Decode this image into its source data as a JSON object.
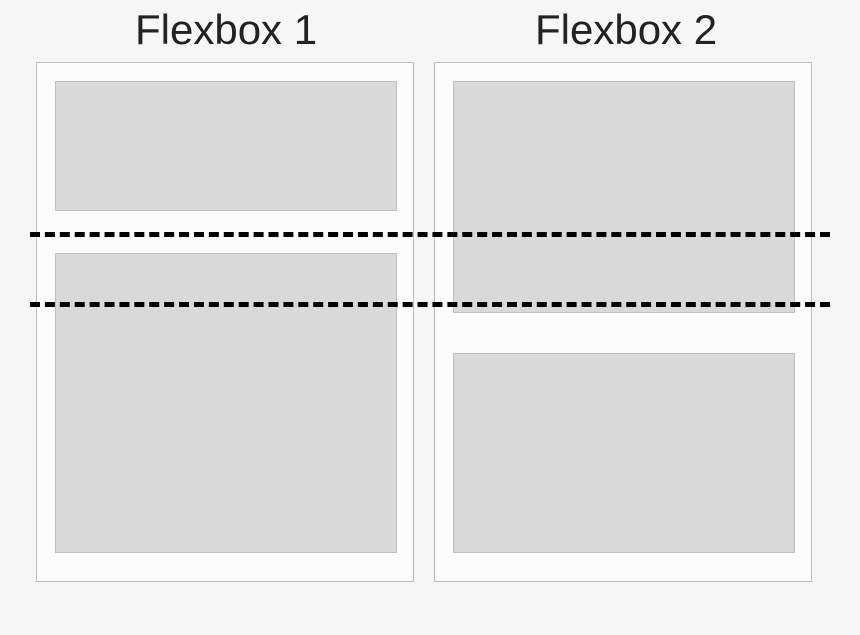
{
  "headings": {
    "left": "Flexbox 1",
    "right": "Flexbox 2"
  }
}
